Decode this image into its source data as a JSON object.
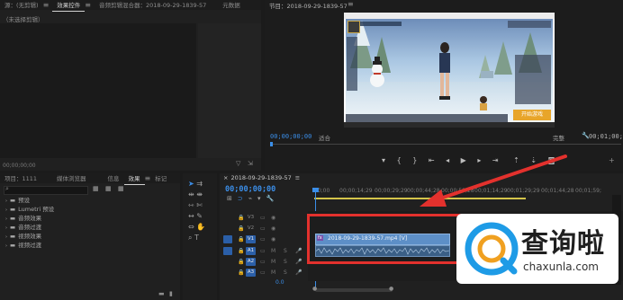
{
  "source_panel": {
    "tabs": [
      "源：(无剪辑)",
      "效果控件",
      "音频剪辑混合器：2018-09-29-1839-57",
      "元数据"
    ],
    "no_clip_label": "（未选择剪辑）",
    "timecode": "00;00;00;00"
  },
  "program_monitor": {
    "title": "节目：2018-09-29-1839-57",
    "timecode_left": "00;00;00;00",
    "fit_label": "适合",
    "quality_label": "完整",
    "timecode_right": "00;01;00;0"
  },
  "game_screen": {
    "start_button": "开始游戏"
  },
  "project_panel": {
    "tabs": [
      "项目：1111",
      "媒体浏览器",
      "信息",
      "效果",
      "标记"
    ],
    "search_placeholder": "",
    "tree": [
      {
        "label": "预设"
      },
      {
        "label": "Lumetri 预设"
      },
      {
        "label": "音频效果"
      },
      {
        "label": "音频过渡"
      },
      {
        "label": "视频效果"
      },
      {
        "label": "视频过渡"
      }
    ]
  },
  "timeline": {
    "title": "2018-09-29-1839-57",
    "timecode": "00;00;00;00",
    "ruler": [
      "00;00",
      "00;00;14;29",
      "00;00;29;29",
      "00;00;44;28",
      "00;00;59;28",
      "00;01;14;29",
      "00;01;29;29",
      "00;01;44;28",
      "00;01;59;"
    ],
    "video_tracks": [
      "V3",
      "V2",
      "V1"
    ],
    "audio_tracks": [
      "A1",
      "A2",
      "A3"
    ],
    "clip_label": "2018-09-29-1839-57.mp4 [V]"
  },
  "watermark": {
    "title": "查询啦",
    "url": "chaxunla.com"
  },
  "colors": {
    "accent_blue": "#3b8ee8",
    "highlight_red": "#e3312d",
    "clip_video": "#5d8fc7",
    "clip_audio": "#3b5f86",
    "watermark_blue": "#1e9be6"
  }
}
